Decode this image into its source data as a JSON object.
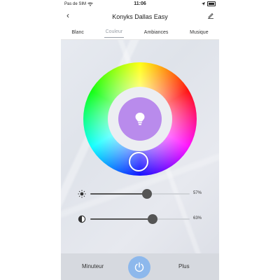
{
  "status_bar": {
    "carrier": "Pas de SIM",
    "time": "11:06"
  },
  "header": {
    "title": "Konyks Dallas Easy"
  },
  "tabs": [
    {
      "label": "Blanc",
      "active": false
    },
    {
      "label": "Couleur",
      "active": true
    },
    {
      "label": "Ambiances",
      "active": false
    },
    {
      "label": "Musique",
      "active": false
    }
  ],
  "color_picker": {
    "selected_color": "#b98bec"
  },
  "sliders": {
    "brightness": {
      "value": 57,
      "label": "57%",
      "icon": "sun-icon"
    },
    "contrast": {
      "value": 63,
      "label": "63%",
      "icon": "contrast-icon"
    }
  },
  "bottom_bar": {
    "timer_label": "Minuteur",
    "more_label": "Plus",
    "power_color": "#8db8ec"
  },
  "colors": {
    "accent": "#8db8ec",
    "bulb": "#b98bec",
    "track": "#d0d3d8",
    "thumb": "#555555"
  }
}
